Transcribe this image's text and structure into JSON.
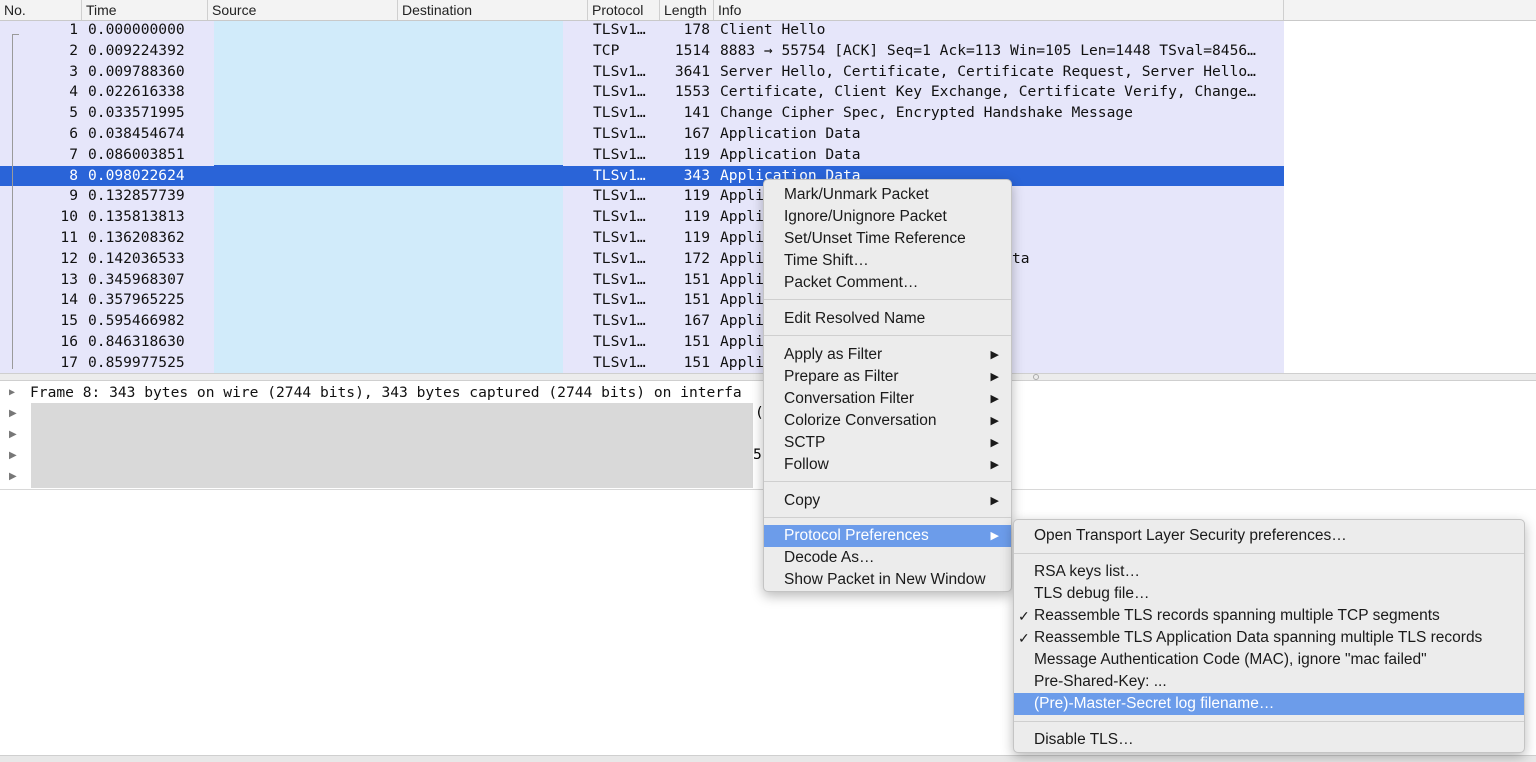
{
  "columns": {
    "no": "No.",
    "time": "Time",
    "source": "Source",
    "destination": "Destination",
    "protocol": "Protocol",
    "length": "Length",
    "info": "Info"
  },
  "packets": [
    {
      "no": "1",
      "time": "0.000000000",
      "protocol": "TLSv1…",
      "length": "178",
      "info": "Client Hello"
    },
    {
      "no": "2",
      "time": "0.009224392",
      "protocol": "TCP",
      "length": "1514",
      "info": "8883 → 55754 [ACK] Seq=1 Ack=113 Win=105 Len=1448 TSval=8456…"
    },
    {
      "no": "3",
      "time": "0.009788360",
      "protocol": "TLSv1…",
      "length": "3641",
      "info": "Server Hello, Certificate, Certificate Request, Server Hello…"
    },
    {
      "no": "4",
      "time": "0.022616338",
      "protocol": "TLSv1…",
      "length": "1553",
      "info": "Certificate, Client Key Exchange, Certificate Verify, Change…"
    },
    {
      "no": "5",
      "time": "0.033571995",
      "protocol": "TLSv1…",
      "length": "141",
      "info": "Change Cipher Spec, Encrypted Handshake Message"
    },
    {
      "no": "6",
      "time": "0.038454674",
      "protocol": "TLSv1…",
      "length": "167",
      "info": "Application Data"
    },
    {
      "no": "7",
      "time": "0.086003851",
      "protocol": "TLSv1…",
      "length": "119",
      "info": "Application Data"
    },
    {
      "no": "8",
      "time": "0.098022624",
      "protocol": "TLSv1…",
      "length": "343",
      "info": "Application Data"
    },
    {
      "no": "9",
      "time": "0.132857739",
      "protocol": "TLSv1…",
      "length": "119",
      "info": "Appli"
    },
    {
      "no": "10",
      "time": "0.135813813",
      "protocol": "TLSv1…",
      "length": "119",
      "info": "Appli"
    },
    {
      "no": "11",
      "time": "0.136208362",
      "protocol": "TLSv1…",
      "length": "119",
      "info": "Appli"
    },
    {
      "no": "12",
      "time": "0.142036533",
      "protocol": "TLSv1…",
      "length": "172",
      "info": "Appli",
      "info_tail": "ta"
    },
    {
      "no": "13",
      "time": "0.345968307",
      "protocol": "TLSv1…",
      "length": "151",
      "info": "Appli"
    },
    {
      "no": "14",
      "time": "0.357965225",
      "protocol": "TLSv1…",
      "length": "151",
      "info": "Appli"
    },
    {
      "no": "15",
      "time": "0.595466982",
      "protocol": "TLSv1…",
      "length": "167",
      "info": "Appli"
    },
    {
      "no": "16",
      "time": "0.846318630",
      "protocol": "TLSv1…",
      "length": "151",
      "info": "Appli"
    },
    {
      "no": "17",
      "time": "0.859977525",
      "protocol": "TLSv1…",
      "length": "151",
      "info": "Appli"
    }
  ],
  "selected_packet_index": 7,
  "details": {
    "frame_line": "Frame 8: 343 bytes on wire (2744 bits), 343 bytes captured (2744 bits) on interfa",
    "frag1": "(",
    "frag2": "5"
  },
  "context_menu": {
    "items": [
      {
        "label": "Mark/Unmark Packet"
      },
      {
        "label": "Ignore/Unignore Packet"
      },
      {
        "label": "Set/Unset Time Reference"
      },
      {
        "label": "Time Shift…"
      },
      {
        "label": "Packet Comment…"
      },
      {
        "label": "Edit Resolved Name"
      },
      {
        "label": "Apply as Filter",
        "submenu": true
      },
      {
        "label": "Prepare as Filter",
        "submenu": true
      },
      {
        "label": "Conversation Filter",
        "submenu": true
      },
      {
        "label": "Colorize Conversation",
        "submenu": true
      },
      {
        "label": "SCTP",
        "submenu": true
      },
      {
        "label": "Follow",
        "submenu": true
      },
      {
        "label": "Copy",
        "submenu": true
      },
      {
        "label": "Protocol Preferences",
        "submenu": true,
        "highlighted": true
      },
      {
        "label": "Decode As…"
      },
      {
        "label": "Show Packet in New Window"
      }
    ]
  },
  "submenu": {
    "items": [
      {
        "label": "Open Transport Layer Security preferences…"
      },
      {
        "label": "RSA keys list…"
      },
      {
        "label": "TLS debug file…"
      },
      {
        "label": "Reassemble TLS records spanning multiple TCP segments",
        "checked": true
      },
      {
        "label": "Reassemble TLS Application Data spanning multiple TLS records",
        "checked": true
      },
      {
        "label": "Message Authentication Code (MAC), ignore \"mac failed\""
      },
      {
        "label": "Pre-Shared-Key: ..."
      },
      {
        "label": "(Pre)-Master-Secret log filename…",
        "highlighted": true
      },
      {
        "label": "Disable TLS…"
      }
    ]
  },
  "glyphs": {
    "arrow": "▶",
    "check": "✓",
    "tree_expand": "▶"
  },
  "colors": {
    "row_bg": "#e6e6fa",
    "selected_row": "#2a64d8",
    "menu_highlight": "#6c9cea",
    "address_mask": "#d1ebfa"
  }
}
